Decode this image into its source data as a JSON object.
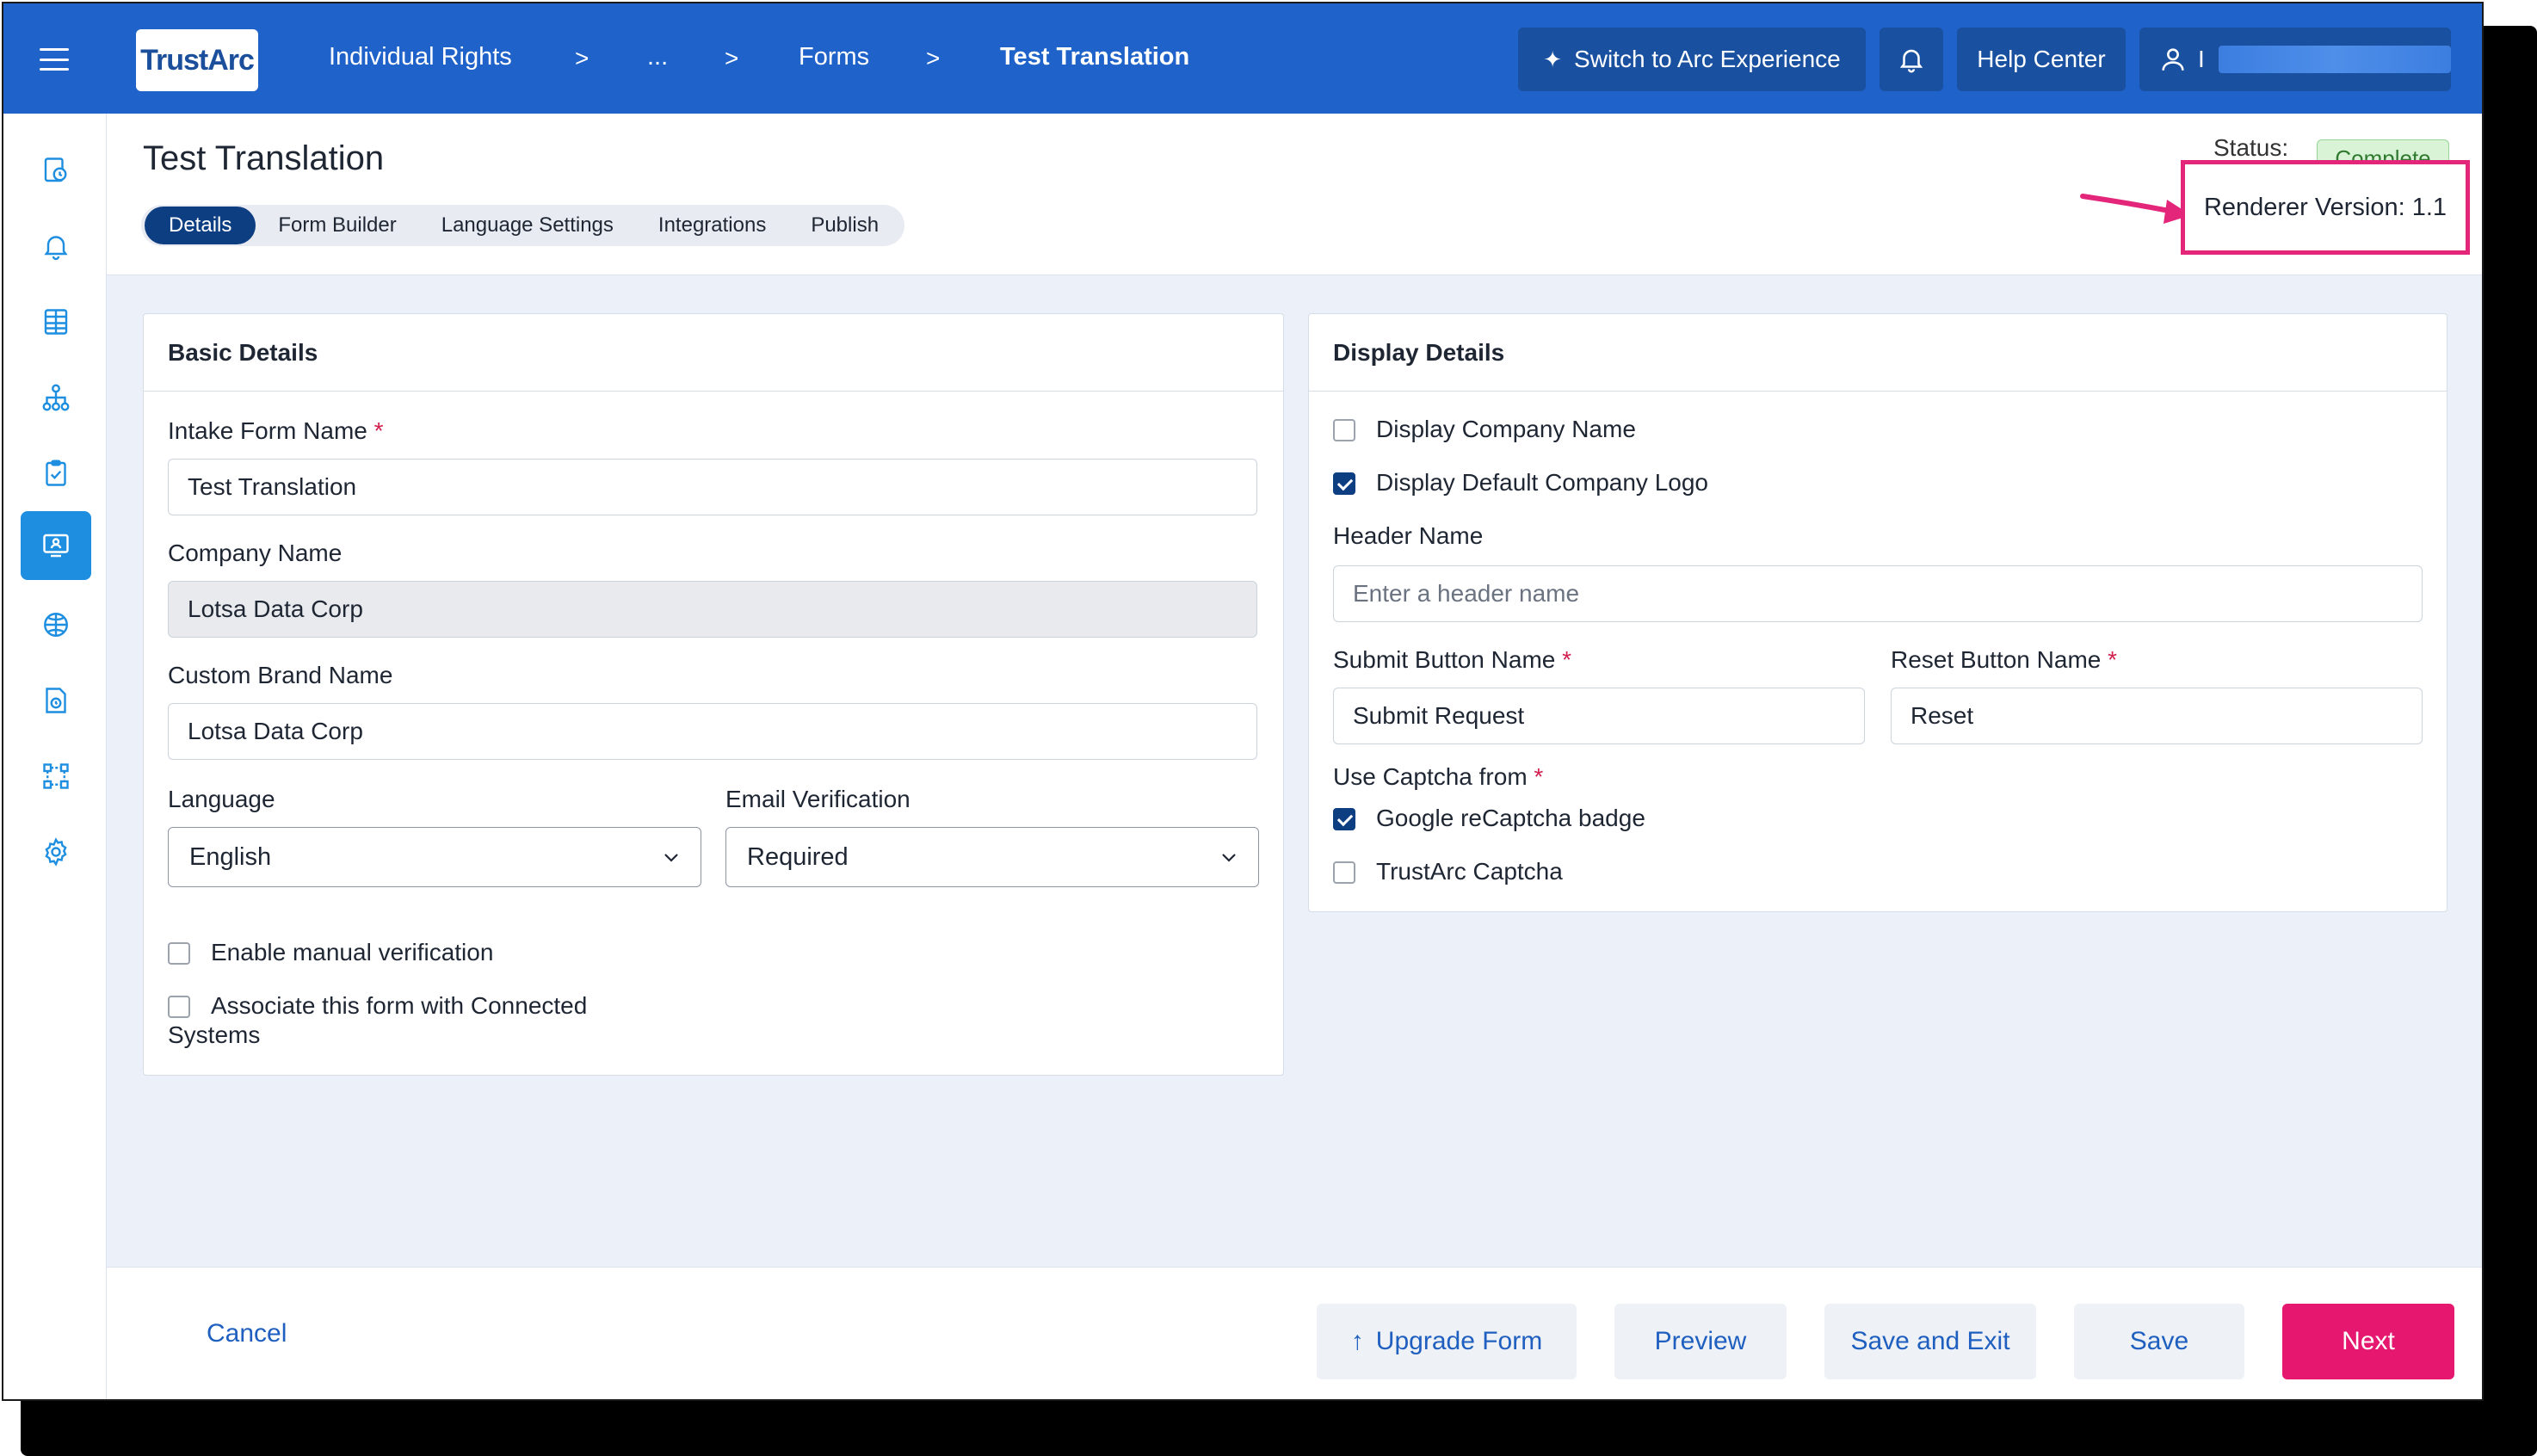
{
  "topbar": {
    "logo_text": "TrustArc",
    "breadcrumbs": [
      "Individual Rights",
      "...",
      "Forms",
      "Test Translation"
    ],
    "separator": ">",
    "switch_label": "Switch to Arc Experience",
    "help_label": "Help Center",
    "user_initial": "I"
  },
  "sidebar": {
    "items": [
      "dashboard-icon",
      "bell-icon",
      "table-icon",
      "network-icon",
      "clipboard-check-icon",
      "monitor-user-icon",
      "globe-brain-icon",
      "document-clock-icon",
      "workflow-icon",
      "gear-icon"
    ],
    "active_index": 5,
    "accent": "#1e8ee0"
  },
  "header": {
    "title": "Test Translation",
    "tabs": [
      "Details",
      "Form Builder",
      "Language Settings",
      "Integrations",
      "Publish"
    ],
    "active_tab": "Details",
    "status_label": "Status:",
    "status_value": "Complete",
    "renderer_version": "Renderer Version: 1.1"
  },
  "basic": {
    "title": "Basic Details",
    "form_name_label": "Intake Form Name",
    "form_name_value": "Test Translation",
    "company_label": "Company Name",
    "company_value": "Lotsa Data Corp",
    "brand_label": "Custom Brand Name",
    "brand_value": "Lotsa Data Corp",
    "language_label": "Language",
    "language_value": "English",
    "email_label": "Email Verification",
    "email_value": "Required",
    "manual_label": "Enable manual verification",
    "associate_label": "Associate this form with Connected",
    "associate_label_2": "Systems"
  },
  "display": {
    "title": "Display Details",
    "company_name_label": "Display Company Name",
    "logo_label": "Display Default Company Logo",
    "header_label": "Header Name",
    "header_placeholder": "Enter a header name",
    "submit_label": "Submit Button Name",
    "submit_value": "Submit Request",
    "reset_label": "Reset Button Name",
    "reset_value": "Reset",
    "captcha_label": "Use Captcha from",
    "google_label": "Google reCaptcha badge",
    "trustarc_label": "TrustArc Captcha"
  },
  "footer": {
    "cancel": "Cancel",
    "upgrade": "Upgrade Form",
    "preview": "Preview",
    "save_exit": "Save and Exit",
    "save": "Save",
    "next": "Next"
  },
  "colors": {
    "topbar": "#1f62c9",
    "primary_dark": "#0d3e82",
    "next_button": "#e5176e",
    "highlight": "#e3267a",
    "required": "#d2204e"
  }
}
